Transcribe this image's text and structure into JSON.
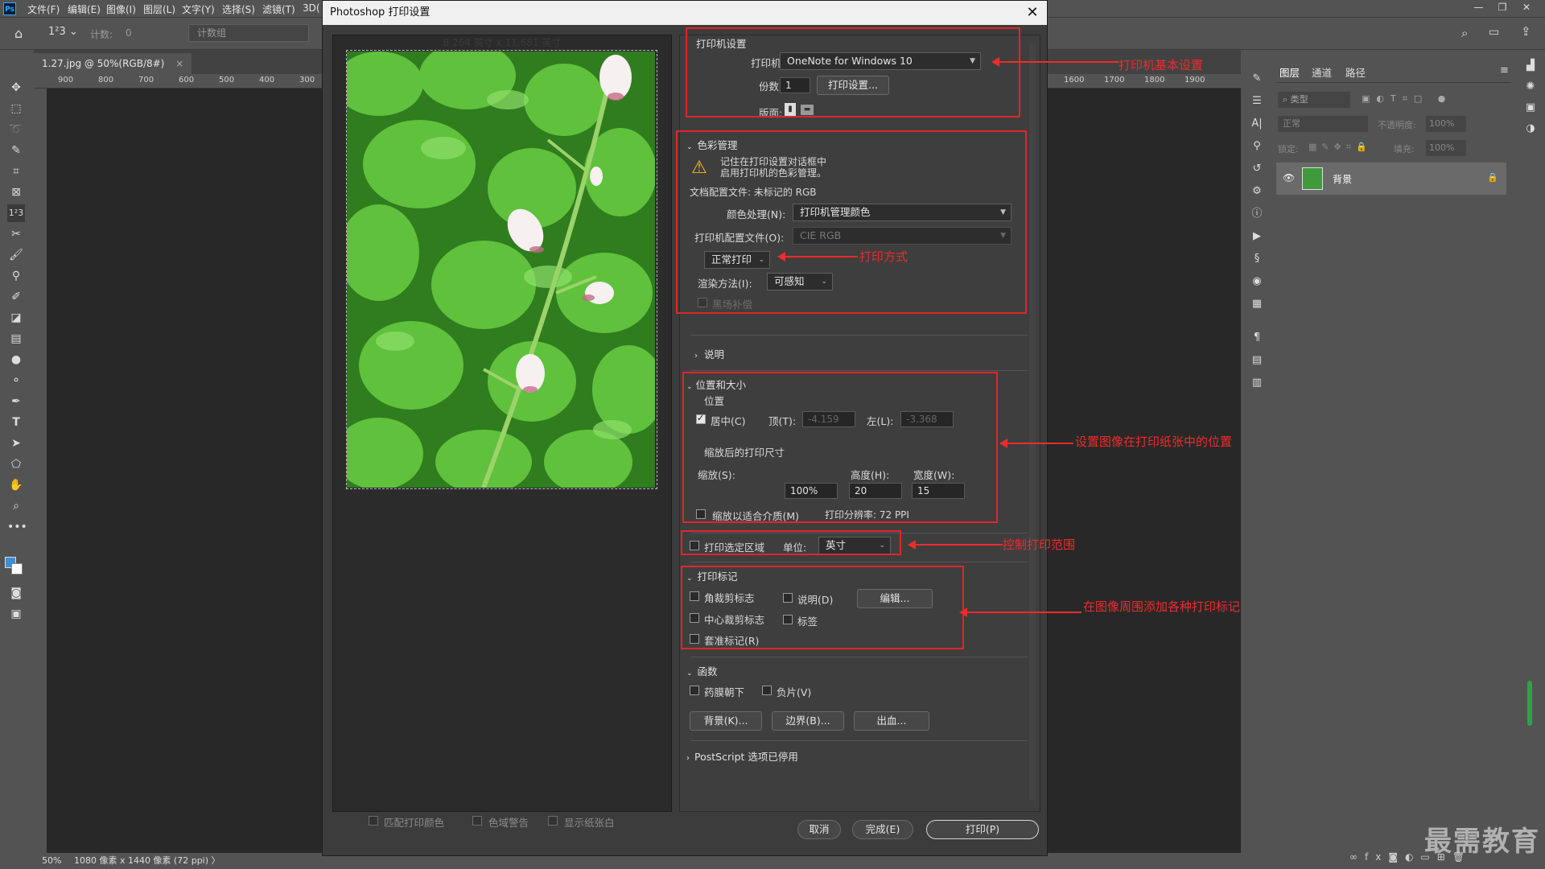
{
  "menubar": {
    "logo": "Ps",
    "items": [
      "文件(F)",
      "编辑(E)",
      "图像(I)",
      "图层(L)",
      "文字(Y)",
      "选择(S)",
      "滤镜(T)",
      "3D("
    ],
    "window_controls": [
      "—",
      "❐",
      "✕"
    ]
  },
  "optionsbar": {
    "count_label": "计数:",
    "count_value": "0",
    "count_group": "计数组"
  },
  "document": {
    "tab_title": "1.27.jpg @ 50%(RGB/8#)",
    "ruler_ticks": [
      "900",
      "800",
      "700",
      "600",
      "500",
      "400",
      "300"
    ],
    "ruler_ticks_right": [
      "1600",
      "1700",
      "1800",
      "1900"
    ],
    "status_zoom": "50%",
    "status_info": "1080 像素 x 1440 像素 (72 ppi)"
  },
  "dialog": {
    "title": "Photoshop 打印设置",
    "paper_size_text": "8.264 英寸 x 11.681 英寸",
    "printer_section": {
      "title": "打印机设置",
      "printer_label": "打印机:",
      "printer_value": "OneNote for Windows 10",
      "copies_label": "份数:",
      "copies_value": "1",
      "print_settings_button": "打印设置...",
      "layout_label": "版面:"
    },
    "color_section": {
      "title": "色彩管理",
      "warning_line1": "记住在打印设置对话框中",
      "warning_line2": "启用打印机的色彩管理。",
      "doc_profile": "文档配置文件: 未标记的 RGB",
      "color_handling_label": "颜色处理(N):",
      "color_handling_value": "打印机管理颜色",
      "printer_profile_label": "打印机配置文件(O):",
      "printer_profile_value": "CIE RGB",
      "normal_print": "正常打印",
      "render_label": "渲染方法(I):",
      "render_value": "可感知",
      "black_point": "黑场补偿"
    },
    "description_section": {
      "title": "说明"
    },
    "position_section": {
      "title": "位置和大小",
      "position_label": "位置",
      "center_label": "居中(C)",
      "top_label": "顶(T):",
      "top_value": "-4.159",
      "left_label": "左(L):",
      "left_value": "-3.368",
      "scaled_label": "缩放后的打印尺寸",
      "scale_label": "缩放(S):",
      "scale_value": "100%",
      "height_label": "高度(H):",
      "height_value": "20",
      "width_label": "宽度(W):",
      "width_value": "15",
      "fit_media": "缩放以适合介质(M)",
      "resolution": "打印分辨率: 72 PPI"
    },
    "range_section": {
      "print_selection": "打印选定区域",
      "units_label": "单位:",
      "units_value": "英寸"
    },
    "marks_section": {
      "title": "打印标记",
      "corner_crop": "角裁剪标志",
      "description": "说明(D)",
      "edit_button": "编辑...",
      "center_crop": "中心裁剪标志",
      "labels": "标签",
      "registration": "套准标记(R)"
    },
    "functions_section": {
      "title": "函数",
      "emulsion_down": "药膜朝下",
      "negative": "负片(V)",
      "background_button": "背景(K)...",
      "border_button": "边界(B)...",
      "bleed_button": "出血..."
    },
    "postscript": "PostScript 选项已停用",
    "preview_options": [
      "匹配打印颜色",
      "色域警告",
      "显示纸张白"
    ],
    "cancel_button": "取消",
    "done_button": "完成(E)",
    "print_button": "打印(P)"
  },
  "annotations": {
    "printer_basic": "打印机基本设置",
    "print_method": "打印方式",
    "image_position": "设置图像在打印纸张中的位置",
    "print_range": "控制打印范围",
    "print_marks": "在图像周围添加各种打印标记"
  },
  "layers_panel": {
    "tabs": [
      "图层",
      "通道",
      "路径"
    ],
    "kind_label": "类型",
    "blend_mode": "正常",
    "opacity_label": "不透明度:",
    "opacity_value": "100%",
    "lock_label": "锁定:",
    "fill_label": "填充:",
    "fill_value": "100%",
    "layer_name": "背景"
  },
  "watermark": "最需教育",
  "colors": {
    "accent_red": "#e0262a",
    "ps_blue": "#31a8ff",
    "panel_bg": "#535353",
    "dialog_bg": "#3c3c3c"
  }
}
